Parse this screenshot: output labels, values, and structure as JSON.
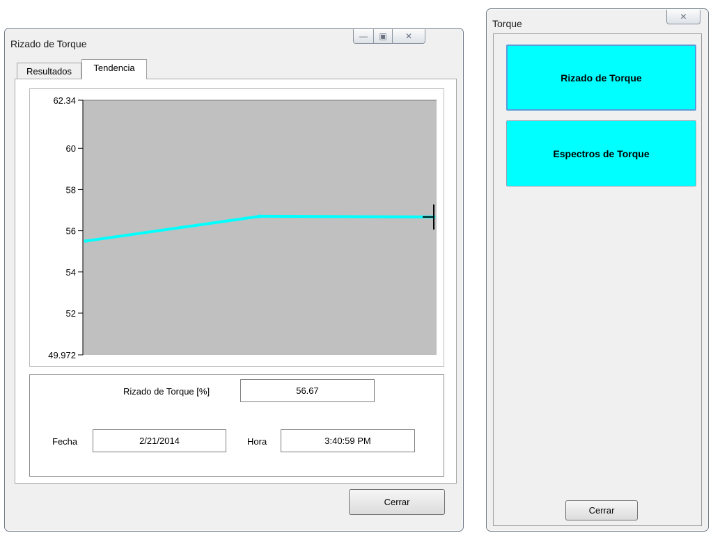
{
  "main_window": {
    "title": "Rizado de Torque",
    "tabs": [
      {
        "label": "Resultados",
        "active": false
      },
      {
        "label": "Tendencia",
        "active": true
      }
    ],
    "close_button": "Cerrar"
  },
  "readout": {
    "rizado_label": "Rizado de Torque [%]",
    "rizado_value": "56.67",
    "fecha_label": "Fecha",
    "fecha_value": "2/21/2014",
    "hora_label": "Hora",
    "hora_value": "3:40:59 PM"
  },
  "side_window": {
    "title": "Torque",
    "buttons": [
      "Rizado de Torque",
      "Espectros de Torque"
    ],
    "close_button": "Cerrar"
  },
  "icons": [
    "minimize-icon",
    "restore-icon",
    "close-icon"
  ],
  "colors": {
    "series": "#00ffff",
    "plot_background": "#c0c0c0",
    "button_accent": "#00ffff"
  },
  "chart_data": {
    "type": "line",
    "title": "",
    "xlabel": "",
    "ylabel": "",
    "ylim": [
      49.972,
      62.34
    ],
    "yticks": [
      "62.34",
      "60",
      "58",
      "56",
      "54",
      "52",
      "49.972"
    ],
    "grid": false,
    "series": [
      {
        "values": [
          55.5,
          56.7,
          56.67
        ]
      }
    ],
    "cursor_on_last_point": true
  }
}
